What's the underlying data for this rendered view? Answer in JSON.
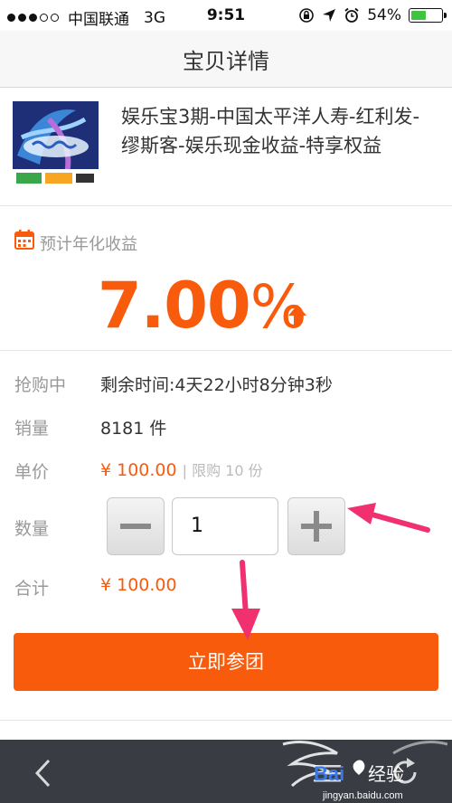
{
  "status_bar": {
    "carrier": "中国联通",
    "network": "3G",
    "time": "9:51",
    "battery": "54%",
    "battery_level": 0.54
  },
  "navbar": {
    "title": "宝贝详情"
  },
  "product": {
    "name": "娱乐宝3期-中国太平洋人寿-红利发-缪斯客-娱乐现金收益-特享权益",
    "thumbnail_icon": "china-dream-show-banner"
  },
  "yield": {
    "label": "预计年化收益",
    "value": "7.00",
    "unit": "%"
  },
  "details": {
    "status_label": "抢购中",
    "remaining_time": "剩余时间:4天22小时8分钟3秒",
    "sales_label": "销量",
    "sales_value": "8181 件",
    "unit_price_label": "单价",
    "unit_price": "¥ 100.00",
    "limit": "| 限购 10 份",
    "quantity_label": "数量",
    "quantity_value": "1",
    "total_label": "合计",
    "total_value": "¥ 100.00"
  },
  "join_button": "立即参团",
  "watermark": {
    "text": "Bai 经验",
    "url": "jingyan.baidu.com"
  },
  "colors": {
    "accent": "#f95b0d",
    "arrow_annotation": "#f0306f",
    "bottom_bar": "#3a3c44"
  }
}
